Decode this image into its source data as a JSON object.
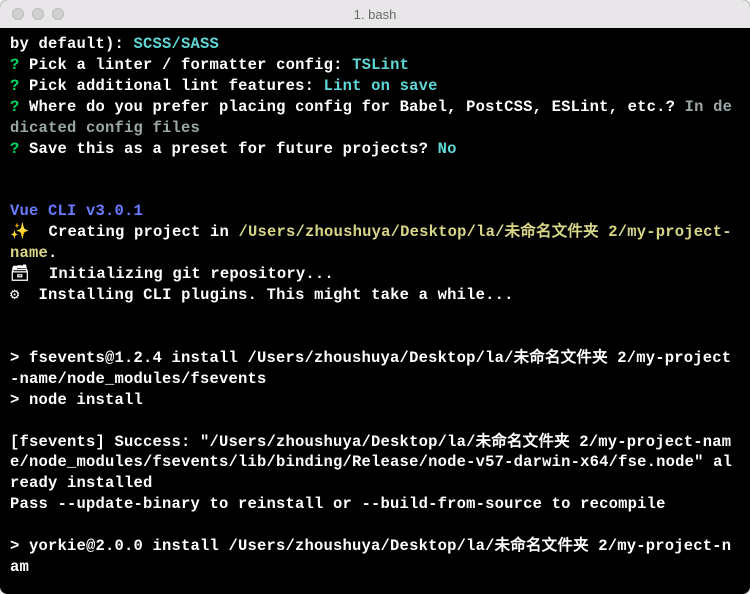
{
  "titlebar": {
    "title": "1. bash"
  },
  "lines": {
    "l1_a": "by default): ",
    "l1_b": "SCSS/SASS",
    "q": "?",
    "sp": " ",
    "l2_q": "Pick a linter / formatter config:",
    "l2_a": "TSLint",
    "l3_q": "Pick additional lint features:",
    "l3_a": "Lint on save",
    "l4_q": "Where do you prefer placing config for Babel, PostCSS, ESLint, etc.?",
    "l4_a": "In dedicated config files",
    "l5_q": "Save this as a preset for future projects?",
    "l5_a": "No",
    "blank": "",
    "cli": "Vue CLI v3.0.1",
    "spark": "✨",
    "creating_a": "  Creating project in ",
    "creating_b": "/Users/zhoushuya/Desktop/la/未命名文件夹 2/my-project-name",
    "creating_c": ".",
    "pkg": "🗃",
    "init": "  Initializing git repository...",
    "gear": "⚙",
    "plug": "  Installing CLI plugins. This might take a while...",
    "fse1": "> fsevents@1.2.4 install /Users/zhoushuya/Desktop/la/未命名文件夹 2/my-project-name/node_modules/fsevents",
    "fse2": "> node install",
    "succ": "[fsevents] Success: \"/Users/zhoushuya/Desktop/la/未命名文件夹 2/my-project-name/node_modules/fsevents/lib/binding/Release/node-v57-darwin-x64/fse.node\" already installed",
    "pass": "Pass --update-binary to reinstall or --build-from-source to recompile",
    "york": "> yorkie@2.0.0 install /Users/zhoushuya/Desktop/la/未命名文件夹 2/my-project-nam"
  }
}
